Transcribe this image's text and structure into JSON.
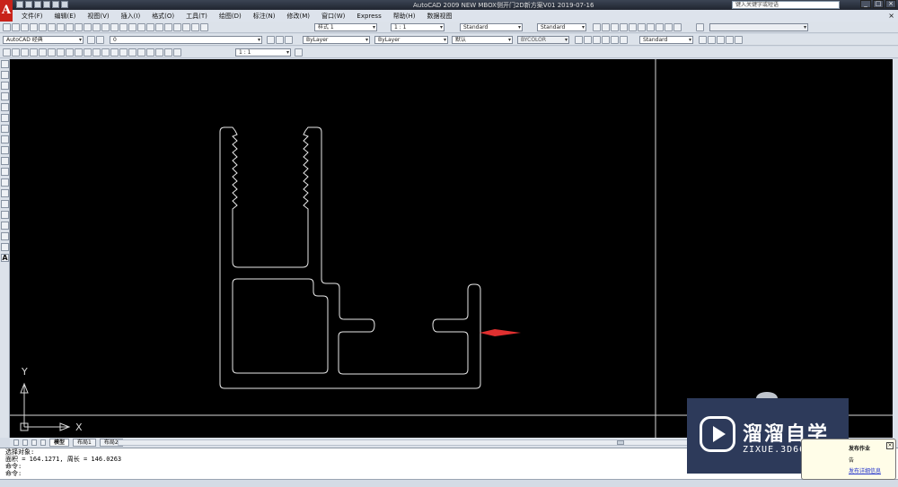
{
  "window": {
    "title": "AutoCAD 2009  NEW MBOX侧开门2D新方案V01 2019-07-16",
    "search_placeholder": "键入关键字或短语",
    "controls": [
      "_",
      "□",
      "×"
    ]
  },
  "menu": {
    "items": [
      "文件(F)",
      "编辑(E)",
      "视图(V)",
      "插入(I)",
      "格式(O)",
      "工具(T)",
      "绘图(D)",
      "标注(N)",
      "修改(M)",
      "窗口(W)",
      "Express",
      "帮助(H)",
      "数据视图"
    ],
    "close": "×"
  },
  "toolbars": {
    "textstyle": "样式 1",
    "scale_top": "1 : 1",
    "dimstyle": "Standard",
    "tablestyle": "Standard",
    "workspace": "AutoCAD 经典",
    "layer": "0",
    "color": "ByLayer",
    "linetype": "ByLayer",
    "lineweight": "默认",
    "plotstyle": "BYCOLOR",
    "mleaderstyle": "Standard",
    "viewport_scale": "1 : 1"
  },
  "ucs": {
    "x_label": "X",
    "y_label": "Y"
  },
  "layout_tabs": {
    "model": "模型",
    "layout1": "布局1",
    "layout2": "布局2"
  },
  "command": {
    "lines": [
      "选择对象:",
      "面积 = 164.1271, 周长 = 146.0263",
      "命令:",
      "命令:"
    ]
  },
  "watermark": {
    "title": "溜溜自学",
    "subtitle": "ZIXUE.3D66.COM"
  },
  "notification": {
    "title": "发布作业",
    "line1": "告",
    "link": "发布详细信息"
  },
  "colors": {
    "canvas": "#000000",
    "arrow": "#e03030",
    "profile": "#e8e8e8",
    "watermark_bg": "#2d3a5a"
  }
}
